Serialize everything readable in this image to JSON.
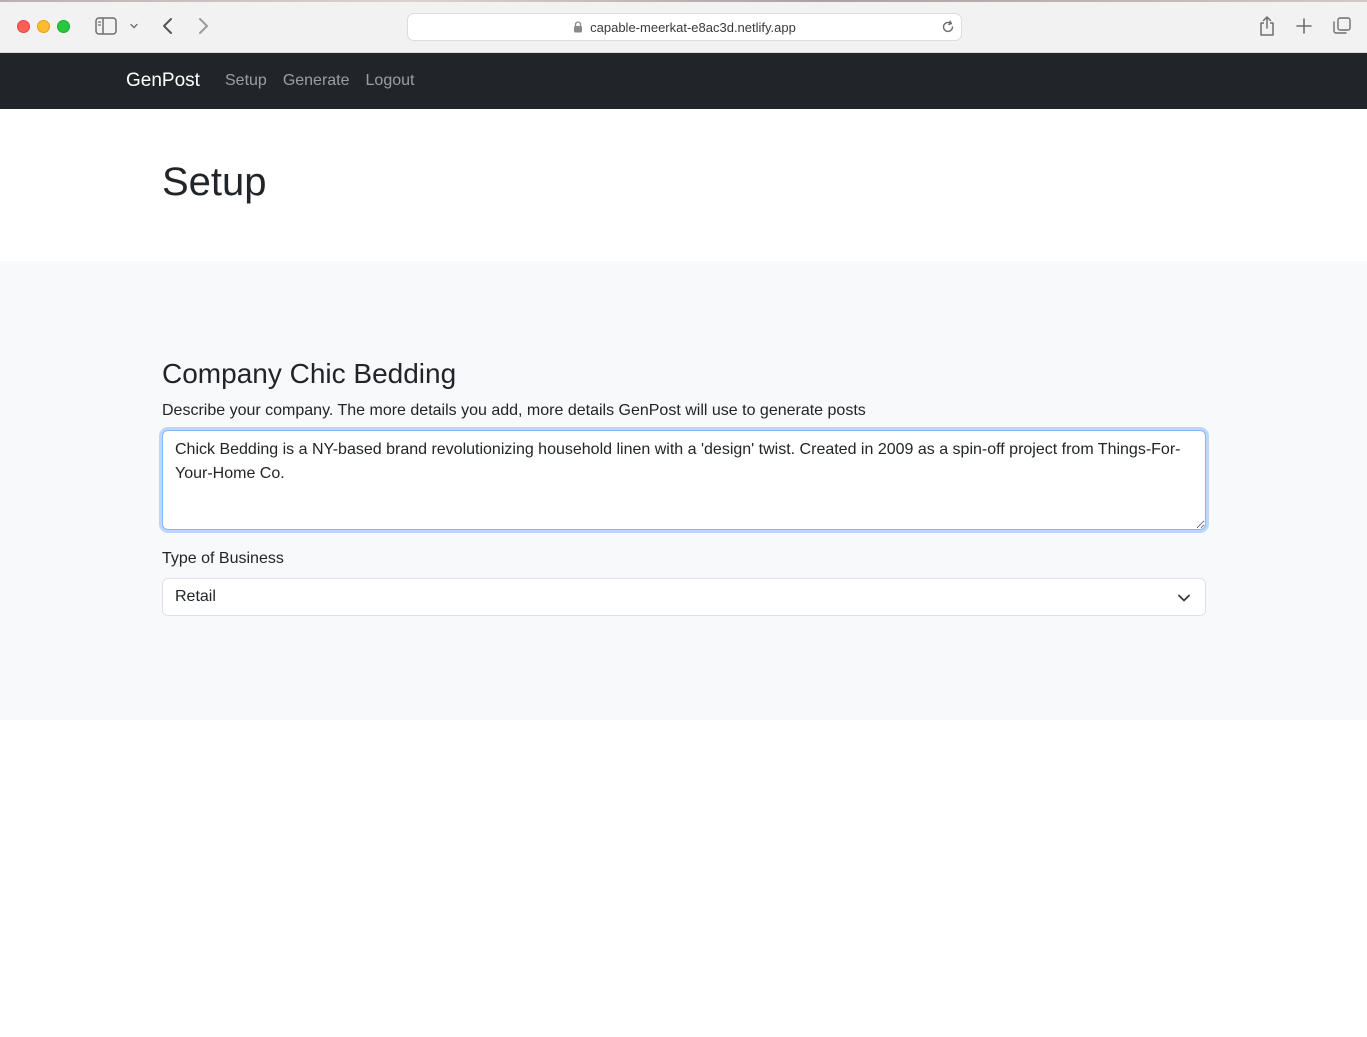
{
  "browser": {
    "url": "capable-meerkat-e8ac3d.netlify.app"
  },
  "navbar": {
    "brand": "GenPost",
    "links": [
      "Setup",
      "Generate",
      "Logout"
    ]
  },
  "header": {
    "title": "Setup"
  },
  "company": {
    "heading": "Company Chic Bedding",
    "help_text": "Describe your company. The more details you add, more details GenPost will use to generate posts",
    "description": "Chick Bedding is a NY-based brand revolutionizing household linen with a 'design' twist. Created in 2009 as a spin-off project from Things-For-Your-Home Co."
  },
  "business_type": {
    "label": "Type of Business",
    "selected": "Retail"
  },
  "colors": {
    "navbar_bg": "#212529",
    "section_bg": "#f8f9fa",
    "focus_border": "#86b7fe"
  }
}
